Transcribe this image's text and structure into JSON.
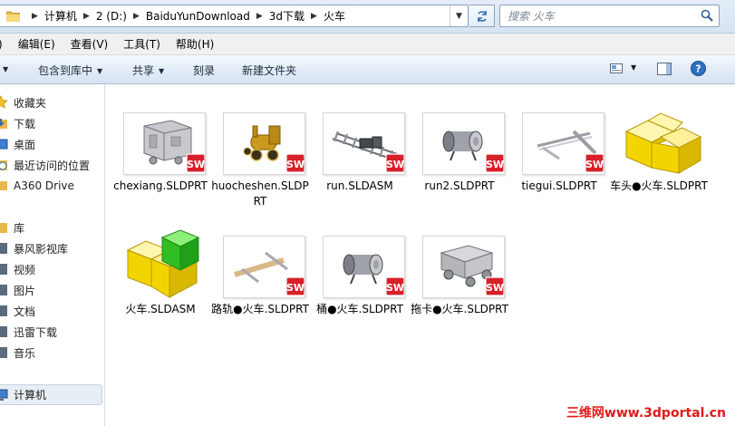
{
  "address": {
    "path": [
      "计算机",
      "2 (D:)",
      "BaiduYunDownload",
      "3d下载",
      "火车"
    ],
    "dropdown_icon": "chevron-down-icon",
    "refresh_icon": "refresh-icon"
  },
  "search": {
    "placeholder": "搜索 火车"
  },
  "menu": [
    "编辑(E)",
    "查看(V)",
    "工具(T)",
    "帮助(H)"
  ],
  "commands": {
    "include_library": "包含到库中",
    "share": "共享",
    "burn": "刻录",
    "new_folder": "新建文件夹"
  },
  "nav": {
    "favorites": "收藏夹",
    "downloads": "下载",
    "desktop": "桌面",
    "recent": "最近访问的位置",
    "a360": "A360 Drive",
    "libraries": "库",
    "storm": "暴风影视库",
    "video": "视频",
    "pictures": "图片",
    "documents": "文档",
    "thunder": "迅雷下载",
    "music": "音乐",
    "computer": "计算机"
  },
  "files": [
    {
      "name": "chexiang.SLDPRT",
      "kind": "part",
      "thumb": "carriage-thumbnail"
    },
    {
      "name": "huocheshen.SLDPRT",
      "kind": "part",
      "thumb": "locomotive-thumbnail"
    },
    {
      "name": "run.SLDASM",
      "kind": "assembly",
      "thumb": "track-thumbnail"
    },
    {
      "name": "run2.SLDPRT",
      "kind": "part",
      "thumb": "barrel-thumbnail"
    },
    {
      "name": "tiegui.SLDPRT",
      "kind": "part",
      "thumb": "rail-thumbnail"
    },
    {
      "name": "车头●火车.SLDPRT",
      "kind": "part-generic",
      "thumb": "yellow-blocks-icon"
    },
    {
      "name": "火车.SLDASM",
      "kind": "assembly-generic",
      "thumb": "yellow-green-blocks-icon"
    },
    {
      "name": "路轨●火车.SLDPRT",
      "kind": "part",
      "thumb": "rail-plank-thumbnail"
    },
    {
      "name": "桶●火车.SLDPRT",
      "kind": "part",
      "thumb": "barrel-thumbnail"
    },
    {
      "name": "拖卡●火车.SLDPRT",
      "kind": "part",
      "thumb": "wagon-thumbnail"
    }
  ],
  "watermark": "三维网www.3dportal.cn",
  "colors": {
    "sw_badge": "#d8202a",
    "block_yellow": "#f2d500",
    "block_green": "#2fbf24",
    "watermark": "#e21a1a"
  }
}
